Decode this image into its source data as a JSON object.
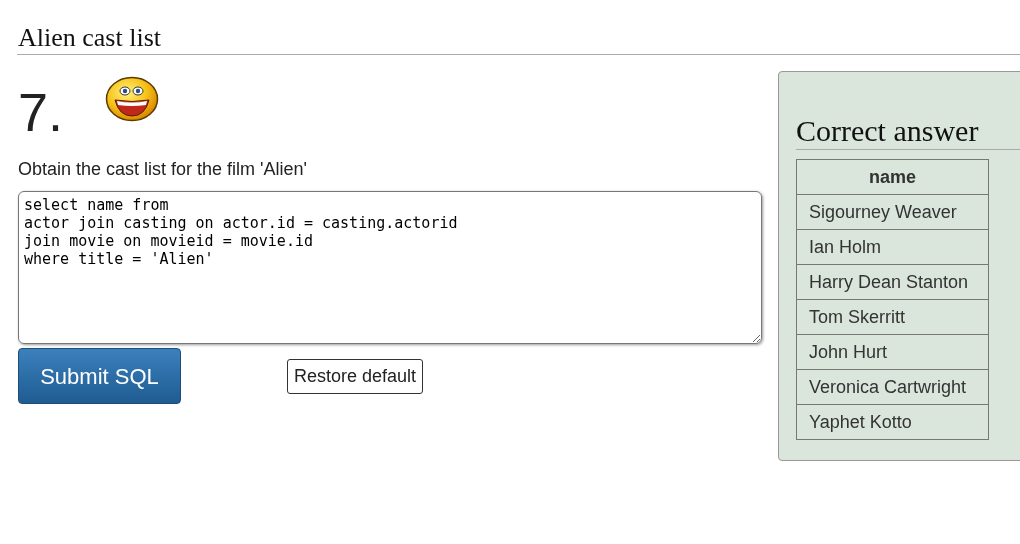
{
  "page_title": "Alien cast list",
  "question": {
    "number": "7.",
    "prompt": "Obtain the cast list for the film 'Alien'"
  },
  "sql_editor": {
    "value": "select name from\nactor join casting on actor.id = casting.actorid\njoin movie on movieid = movie.id\nwhere title = 'Alien'"
  },
  "buttons": [
    {
      "kind": "primary",
      "label": "Submit SQL"
    },
    {
      "kind": "secondary",
      "label": "Restore default"
    }
  ],
  "answer_panel": {
    "title": "Correct answer",
    "columns": [
      "name"
    ],
    "rows": [
      [
        "Sigourney Weaver"
      ],
      [
        "Ian Holm"
      ],
      [
        "Harry Dean Stanton"
      ],
      [
        "Tom Skerritt"
      ],
      [
        "John Hurt"
      ],
      [
        "Veronica Cartwright"
      ],
      [
        "Yaphet Kotto"
      ]
    ]
  }
}
